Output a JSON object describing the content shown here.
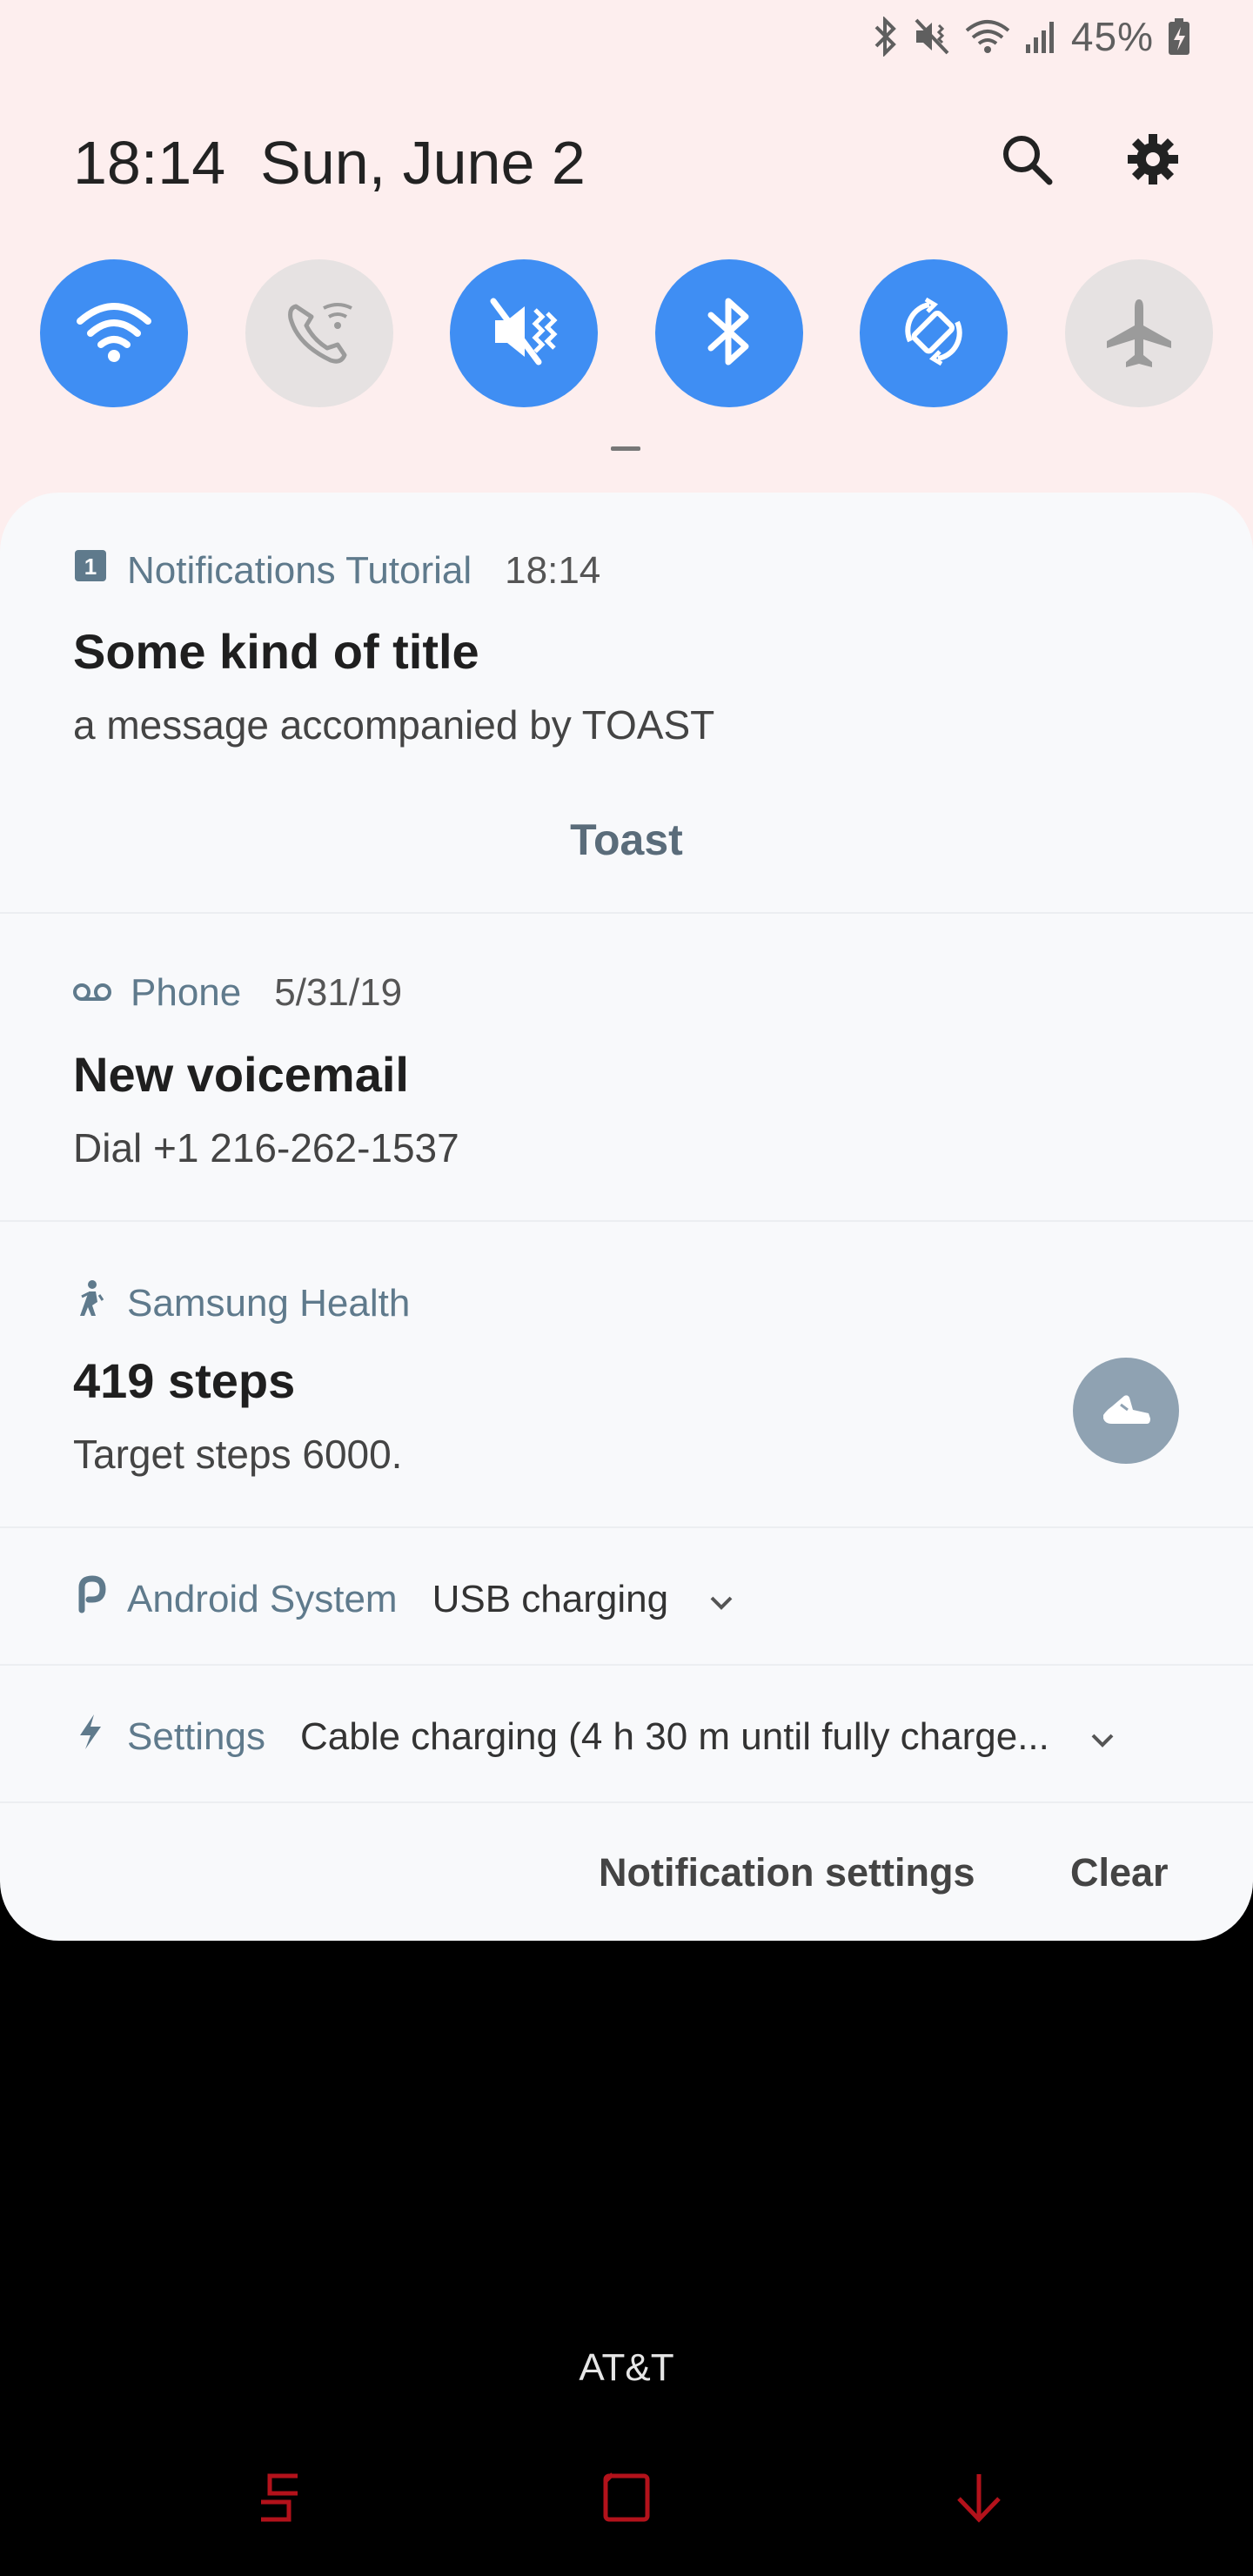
{
  "status_bar": {
    "battery": "45%",
    "icons": [
      "bluetooth-icon",
      "mute-vibrate-icon",
      "wifi-icon",
      "signal-icon",
      "battery-charging-icon"
    ]
  },
  "header": {
    "time": "18:14",
    "date": "Sun, June 2"
  },
  "quick_toggles": [
    {
      "name": "wifi",
      "icon": "wifi-icon",
      "state": "on"
    },
    {
      "name": "wifi-calling",
      "icon": "wifi-calling-icon",
      "state": "off"
    },
    {
      "name": "sound",
      "icon": "vibrate-mute-icon",
      "state": "on"
    },
    {
      "name": "bluetooth",
      "icon": "bluetooth-icon",
      "state": "on"
    },
    {
      "name": "auto-rotate",
      "icon": "auto-rotate-icon",
      "state": "on"
    },
    {
      "name": "airplane-mode",
      "icon": "airplane-icon",
      "state": "off"
    }
  ],
  "notifications": {
    "tutorial": {
      "app": "Notifications Tutorial",
      "time": "18:14",
      "title": "Some kind of title",
      "text": "a message accompanied by TOAST",
      "action": "Toast"
    },
    "phone": {
      "app": "Phone",
      "time": "5/31/19",
      "title": "New voicemail",
      "text": "Dial +1 216-262-1537"
    },
    "health": {
      "app": "Samsung Health",
      "title": "419 steps",
      "text": "Target steps 6000."
    },
    "android_system": {
      "app": "Android System",
      "text": "USB charging"
    },
    "settings": {
      "app": "Settings",
      "text": "Cable charging (4 h 30 m until fully charge..."
    }
  },
  "footer": {
    "notification_settings": "Notification settings",
    "clear": "Clear"
  },
  "carrier": "AT&T",
  "colors": {
    "accent": "#3f8ef3",
    "toggle_off": "#e6e2e2",
    "nav_red": "#b3121b"
  }
}
